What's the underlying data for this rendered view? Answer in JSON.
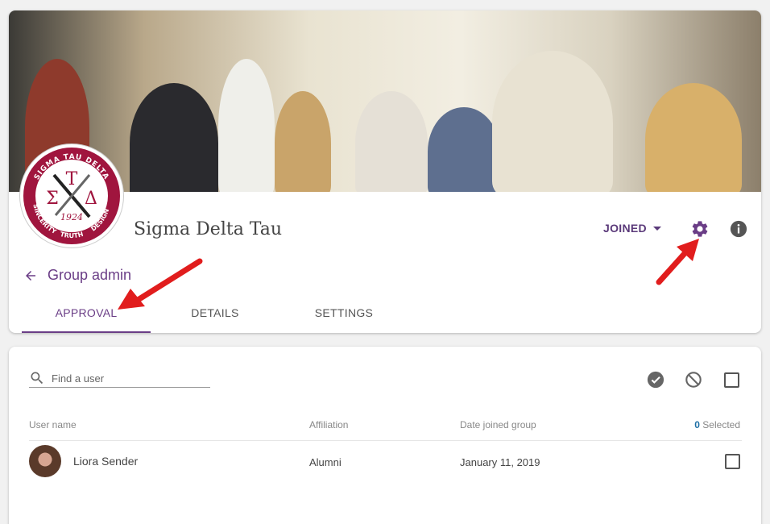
{
  "group": {
    "name": "Sigma Delta Tau",
    "crest": {
      "top_text": "SIGMA TAU DELTA",
      "letters": [
        "Σ",
        "Τ",
        "Δ"
      ],
      "year": "1924",
      "bottom_words": [
        "SINCERITY",
        "TRUTH",
        "DESIGN"
      ]
    },
    "membership_label": "JOINED"
  },
  "nav": {
    "back_label": "Group admin"
  },
  "tabs": [
    {
      "label": "APPROVAL",
      "active": true
    },
    {
      "label": "DETAILS",
      "active": false
    },
    {
      "label": "SETTINGS",
      "active": false
    }
  ],
  "search": {
    "placeholder": "Find a user",
    "value": ""
  },
  "table": {
    "columns": {
      "user": "User name",
      "affiliation": "Affiliation",
      "date": "Date joined group"
    },
    "selected_count": "0",
    "selected_label": "Selected",
    "rows": [
      {
        "name": "Liora Sender",
        "affiliation": "Alumni",
        "date": "January 11, 2019",
        "checked": false
      }
    ]
  },
  "icons": {
    "gear": "settings-gear-icon",
    "info": "info-icon",
    "approve": "check-circle-icon",
    "deny": "block-icon",
    "back": "arrow-left-icon",
    "search": "search-icon"
  },
  "colors": {
    "accent": "#6a3d86",
    "crest": "#a0153e",
    "annotation_arrow": "#e11d1d",
    "count": "#1d6fa5"
  }
}
